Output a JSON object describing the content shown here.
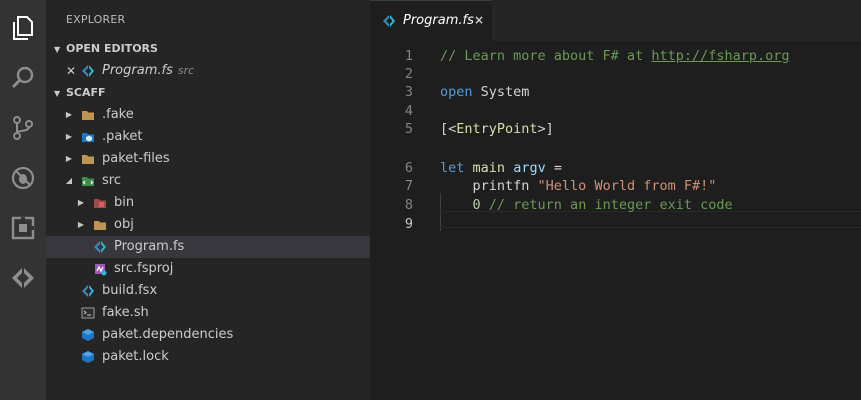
{
  "activity_bar": {
    "items": [
      {
        "icon": "files-icon"
      },
      {
        "icon": "search-icon"
      },
      {
        "icon": "source-control-icon"
      },
      {
        "icon": "debug-icon"
      },
      {
        "icon": "extensions-icon"
      },
      {
        "icon": "fsharp-icon"
      }
    ]
  },
  "sidebar": {
    "title": "EXPLORER",
    "open_editors": {
      "header": "OPEN EDITORS",
      "items": [
        {
          "name": "Program.fs",
          "desc": "src"
        }
      ]
    },
    "project": {
      "header": "SCAFF",
      "items": [
        {
          "label": ".fake",
          "icon": "folder-icon"
        },
        {
          "label": ".paket",
          "icon": "paket-folder-icon"
        },
        {
          "label": "paket-files",
          "icon": "folder-icon"
        },
        {
          "label": "src",
          "icon": "src-folder-icon"
        },
        {
          "label": "bin",
          "icon": "bin-folder-icon"
        },
        {
          "label": "obj",
          "icon": "folder-icon"
        },
        {
          "label": "Program.fs",
          "icon": "fsharp-file-icon"
        },
        {
          "label": "src.fsproj",
          "icon": "fsproj-file-icon"
        },
        {
          "label": "build.fsx",
          "icon": "fsharp-script-icon"
        },
        {
          "label": "fake.sh",
          "icon": "shell-file-icon"
        },
        {
          "label": "paket.dependencies",
          "icon": "paket-file-icon"
        },
        {
          "label": "paket.lock",
          "icon": "paket-file-icon"
        }
      ]
    }
  },
  "editor": {
    "tab": {
      "label": "Program.fs",
      "close": "×"
    },
    "lines": [
      {
        "num": "1",
        "tokens": [
          {
            "t": "// Learn more about F# at ",
            "c": "comment"
          },
          {
            "t": "http://fsharp.org",
            "c": "link"
          }
        ]
      },
      {
        "num": "2",
        "tokens": []
      },
      {
        "num": "3",
        "tokens": [
          {
            "t": "open",
            "c": "kw"
          },
          {
            "t": " System",
            "c": "plain"
          }
        ]
      },
      {
        "num": "4",
        "tokens": []
      },
      {
        "num": "5",
        "tokens": [
          {
            "t": "[<",
            "c": "plain"
          },
          {
            "t": "EntryPoint",
            "c": "attr"
          },
          {
            "t": ">]",
            "c": "plain"
          }
        ]
      },
      {
        "num": "6",
        "tokens": [
          {
            "t": "let",
            "c": "kw"
          },
          {
            "t": " ",
            "c": "plain"
          },
          {
            "t": "main",
            "c": "fn"
          },
          {
            "t": " ",
            "c": "plain"
          },
          {
            "t": "argv",
            "c": "ident"
          },
          {
            "t": " =",
            "c": "plain"
          }
        ]
      },
      {
        "num": "7",
        "tokens": [
          {
            "t": "    printfn ",
            "c": "plain"
          },
          {
            "t": "\"Hello World from F#!\"",
            "c": "str"
          }
        ]
      },
      {
        "num": "8",
        "tokens": [
          {
            "t": "    ",
            "c": "plain"
          },
          {
            "t": "0",
            "c": "num"
          },
          {
            "t": " // return an integer exit code",
            "c": "comment"
          }
        ]
      },
      {
        "num": "9",
        "tokens": []
      }
    ],
    "current_line": "9"
  },
  "colors": {
    "activity_bar": "#333333",
    "sidebar": "#252526",
    "editor": "#1e1e1e",
    "selection": "#37373d"
  }
}
